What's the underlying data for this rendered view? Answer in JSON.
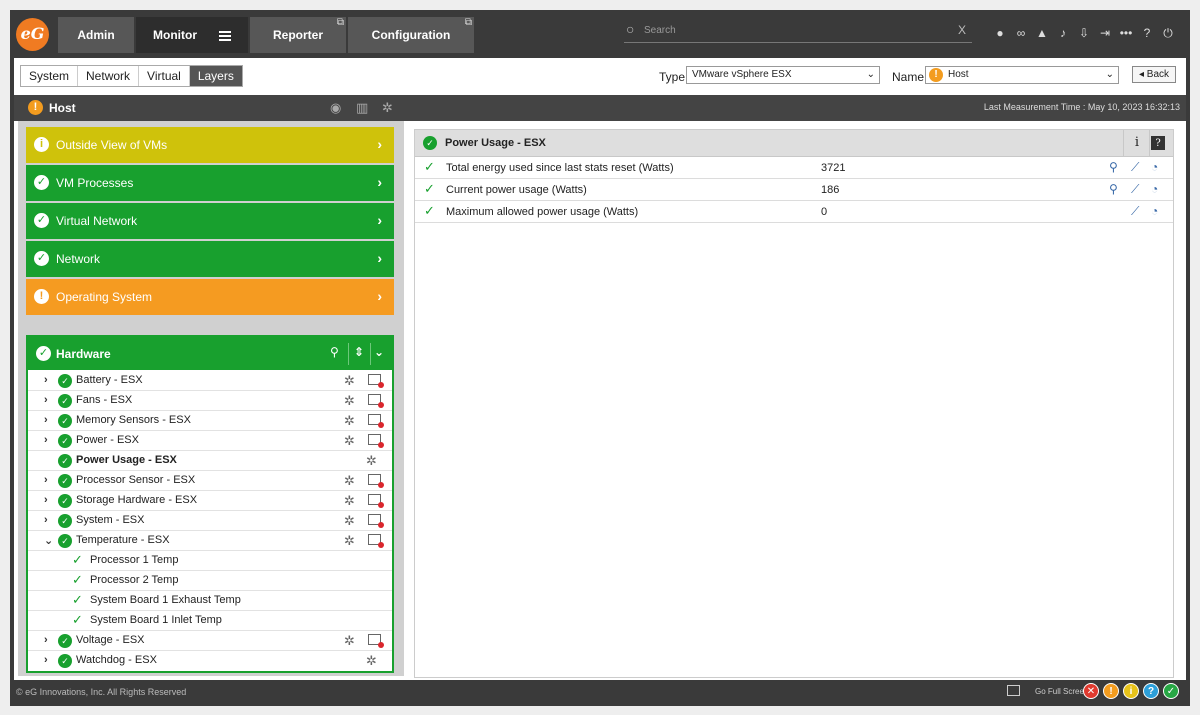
{
  "nav": {
    "logo": "eG",
    "tabs": [
      {
        "label": "Admin"
      },
      {
        "label": "Monitor"
      },
      {
        "label": "Reporter"
      },
      {
        "label": "Configuration"
      }
    ],
    "search_placeholder": "Search",
    "search_clear": "X",
    "tool_icons": [
      "user-icon",
      "link-icon",
      "dashboard-icon",
      "bell-icon",
      "download-icon",
      "signout-icon",
      "more-icon",
      "help-icon",
      "power-icon"
    ]
  },
  "toolbar": {
    "layer_tabs": [
      {
        "label": "System"
      },
      {
        "label": "Network"
      },
      {
        "label": "Virtual"
      },
      {
        "label": "Layers"
      }
    ],
    "type_label": "Type",
    "type_value": "VMware vSphere ESX",
    "name_label": "Name",
    "name_value": "Host",
    "back_label": "Back"
  },
  "header": {
    "title": "Host",
    "measurement_time": "Last Measurement Time : May 10, 2023 16:32:13"
  },
  "layers": [
    {
      "label": "Outside View of VMs",
      "status": "minor"
    },
    {
      "label": "VM Processes",
      "status": "normal"
    },
    {
      "label": "Virtual Network",
      "status": "normal"
    },
    {
      "label": "Network",
      "status": "normal"
    },
    {
      "label": "Operating System",
      "status": "major"
    }
  ],
  "hardware": {
    "title": "Hardware",
    "tests": [
      {
        "label": "Battery - ESX"
      },
      {
        "label": "Fans - ESX"
      },
      {
        "label": "Memory Sensors - ESX"
      },
      {
        "label": "Power - ESX"
      },
      {
        "label": "Power Usage - ESX"
      },
      {
        "label": "Processor Sensor - ESX"
      },
      {
        "label": "Storage Hardware - ESX"
      },
      {
        "label": "System - ESX"
      },
      {
        "label": "Temperature - ESX"
      },
      {
        "label": "Processor 1 Temp"
      },
      {
        "label": "Processor 2 Temp"
      },
      {
        "label": "System Board 1 Exhaust Temp"
      },
      {
        "label": "System Board 1 Inlet Temp"
      },
      {
        "label": "Voltage - ESX"
      },
      {
        "label": "Watchdog - ESX"
      }
    ]
  },
  "details": {
    "title": "Power Usage - ESX",
    "info_icon": "i",
    "help_icon": "?",
    "measures": [
      {
        "name": "Total energy used since last stats reset (Watts)",
        "value": "3721"
      },
      {
        "name": "Current power usage (Watts)",
        "value": "186"
      },
      {
        "name": "Maximum allowed power usage (Watts)",
        "value": "0"
      }
    ]
  },
  "footer": {
    "copyright": "© eG Innovations, Inc. All Rights Reserved",
    "fullscreen_label": "Go Full Screen",
    "status_colors": [
      "#e03a2f",
      "#f39c1f",
      "#e7c21a",
      "#2d9fd9",
      "#27a744"
    ]
  }
}
